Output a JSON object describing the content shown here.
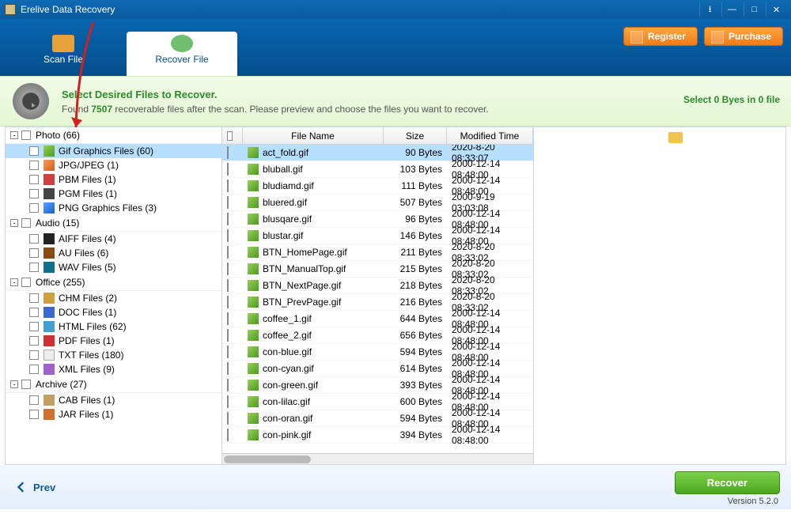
{
  "title": "Erelive Data Recovery",
  "tabs": {
    "scan": "Scan File",
    "recover": "Recover File"
  },
  "header_buttons": {
    "register": "Register",
    "purchase": "Purchase"
  },
  "info": {
    "title": "Select Desired Files to Recover.",
    "found_prefix": "Found ",
    "found_count": "7507",
    "found_suffix": " recoverable files after the scan. Please preview and choose the files you want to recover.",
    "selection": "Select 0 Byes in 0 file"
  },
  "tree": [
    {
      "type": "cat",
      "label": "Photo (66)"
    },
    {
      "type": "item",
      "icon": "gif",
      "label": "Gif Graphics Files (60)",
      "selected": true
    },
    {
      "type": "item",
      "icon": "jpg",
      "label": "JPG/JPEG (1)"
    },
    {
      "type": "item",
      "icon": "pbm",
      "label": "PBM Files (1)"
    },
    {
      "type": "item",
      "icon": "pgm",
      "label": "PGM Files (1)"
    },
    {
      "type": "item",
      "icon": "png",
      "label": "PNG Graphics Files (3)"
    },
    {
      "type": "cat",
      "label": "Audio (15)"
    },
    {
      "type": "item",
      "icon": "aiff",
      "label": "AIFF Files (4)"
    },
    {
      "type": "item",
      "icon": "au",
      "label": "AU Files (6)"
    },
    {
      "type": "item",
      "icon": "wav",
      "label": "WAV Files (5)"
    },
    {
      "type": "cat",
      "label": "Office (255)"
    },
    {
      "type": "item",
      "icon": "chm",
      "label": "CHM Files (2)"
    },
    {
      "type": "item",
      "icon": "doc",
      "label": "DOC Files (1)"
    },
    {
      "type": "item",
      "icon": "html",
      "label": "HTML Files (62)"
    },
    {
      "type": "item",
      "icon": "pdf",
      "label": "PDF Files (1)"
    },
    {
      "type": "item",
      "icon": "txt",
      "label": "TXT Files (180)"
    },
    {
      "type": "item",
      "icon": "xml",
      "label": "XML Files (9)"
    },
    {
      "type": "cat",
      "label": "Archive (27)"
    },
    {
      "type": "item",
      "icon": "cab",
      "label": "CAB Files (1)"
    },
    {
      "type": "item",
      "icon": "jar",
      "label": "JAR Files (1)"
    }
  ],
  "columns": {
    "name": "File Name",
    "size": "Size",
    "time": "Modified Time"
  },
  "files": [
    {
      "name": "act_fold.gif",
      "size": "90 Bytes",
      "time": "2020-8-20 08:33:07",
      "selected": true
    },
    {
      "name": "bluball.gif",
      "size": "103 Bytes",
      "time": "2000-12-14 08:48:00"
    },
    {
      "name": "bludiamd.gif",
      "size": "111 Bytes",
      "time": "2000-12-14 08:48:00"
    },
    {
      "name": "bluered.gif",
      "size": "507 Bytes",
      "time": "2000-9-19 03:03:08"
    },
    {
      "name": "blusqare.gif",
      "size": "96 Bytes",
      "time": "2000-12-14 08:48:00"
    },
    {
      "name": "blustar.gif",
      "size": "146 Bytes",
      "time": "2000-12-14 08:48:00"
    },
    {
      "name": "BTN_HomePage.gif",
      "size": "211 Bytes",
      "time": "2020-8-20 08:33:02"
    },
    {
      "name": "BTN_ManualTop.gif",
      "size": "215 Bytes",
      "time": "2020-8-20 08:33:02"
    },
    {
      "name": "BTN_NextPage.gif",
      "size": "218 Bytes",
      "time": "2020-8-20 08:33:02"
    },
    {
      "name": "BTN_PrevPage.gif",
      "size": "216 Bytes",
      "time": "2020-8-20 08:33:02"
    },
    {
      "name": "coffee_1.gif",
      "size": "644 Bytes",
      "time": "2000-12-14 08:48:00"
    },
    {
      "name": "coffee_2.gif",
      "size": "656 Bytes",
      "time": "2000-12-14 08:48:00"
    },
    {
      "name": "con-blue.gif",
      "size": "594 Bytes",
      "time": "2000-12-14 08:48:00"
    },
    {
      "name": "con-cyan.gif",
      "size": "614 Bytes",
      "time": "2000-12-14 08:48:00"
    },
    {
      "name": "con-green.gif",
      "size": "393 Bytes",
      "time": "2000-12-14 08:48:00"
    },
    {
      "name": "con-lilac.gif",
      "size": "600 Bytes",
      "time": "2000-12-14 08:48:00"
    },
    {
      "name": "con-oran.gif",
      "size": "594 Bytes",
      "time": "2000-12-14 08:48:00"
    },
    {
      "name": "con-pink.gif",
      "size": "394 Bytes",
      "time": "2000-12-14 08:48:00"
    }
  ],
  "footer": {
    "prev": "Prev",
    "recover": "Recover",
    "version": "Version 5.2.0"
  }
}
